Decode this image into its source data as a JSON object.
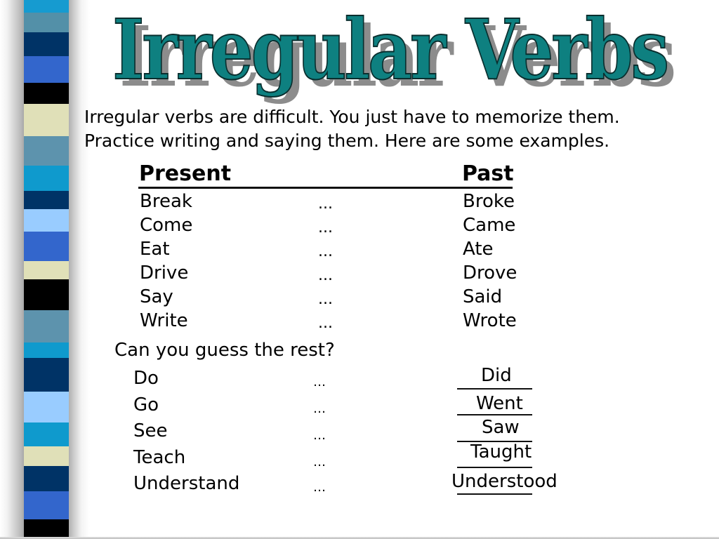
{
  "slide": {
    "title": "Irregular Verbs",
    "title_color": "#0e8080",
    "title_shadow_color": "#8c8c8c",
    "intro_lines": [
      "Irregular verbs are difficult.  You just have to memorize them.",
      "Practice writing and saying them.  Here are some examples."
    ],
    "column_headers": {
      "present": "Present",
      "past": "Past"
    },
    "separator": "...",
    "examples": [
      {
        "present": "Break",
        "past": "Broke"
      },
      {
        "present": "Come",
        "past": "Came"
      },
      {
        "present": "Eat",
        "past": "Ate"
      },
      {
        "present": "Drive",
        "past": "Drove"
      },
      {
        "present": "Say",
        "past": "Said"
      },
      {
        "present": "Write",
        "past": "Wrote"
      }
    ],
    "guess_prompt": "Can you guess the rest?",
    "quiz_separator": "…",
    "quiz": [
      {
        "present": "Do",
        "answer": "Did"
      },
      {
        "present": "Go",
        "answer": "Went"
      },
      {
        "present": "See",
        "answer": "Saw"
      },
      {
        "present": "Teach",
        "answer": "Taught"
      },
      {
        "present": "Understand",
        "answer": "Understood"
      }
    ]
  },
  "decoration": {
    "stripe_colors": [
      "#169bd0",
      "#5390a8",
      "#003366",
      "#3366cc",
      "#000000",
      "#e0e0b8",
      "#5d93ad",
      "#0f9acd",
      "#003366",
      "#99ccff",
      "#3366cc",
      "#e0e0b8",
      "#000000",
      "#5d93ad",
      "#0f9acd",
      "#003366",
      "#99ccff",
      "#0f9acd",
      "#e0e0b8",
      "#003366",
      "#3366cc",
      "#000000"
    ]
  }
}
